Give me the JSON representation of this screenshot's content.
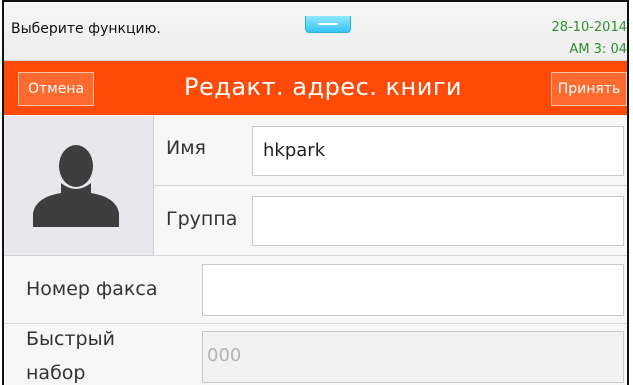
{
  "status": {
    "prompt": "Выберите функцию.",
    "date": "28-10-2014",
    "time": "AM 3: 04"
  },
  "header": {
    "title": "Редакт. адрес. книги",
    "cancel_label": "Отмена",
    "accept_label": "Принять"
  },
  "form": {
    "name": {
      "label": "Имя",
      "value": "hkpark"
    },
    "group": {
      "label": "Группа",
      "value": ""
    },
    "fax": {
      "label": "Номер факса",
      "value": ""
    },
    "speed_dial": {
      "label_line1": "Быстрый",
      "label_line2": "набор",
      "value": "000"
    }
  },
  "colors": {
    "accent": "#ff4a08",
    "handle": "#34c6f4",
    "clock": "#2d8f2d"
  },
  "icons": [
    "drag-handle-icon",
    "person-avatar-icon"
  ]
}
